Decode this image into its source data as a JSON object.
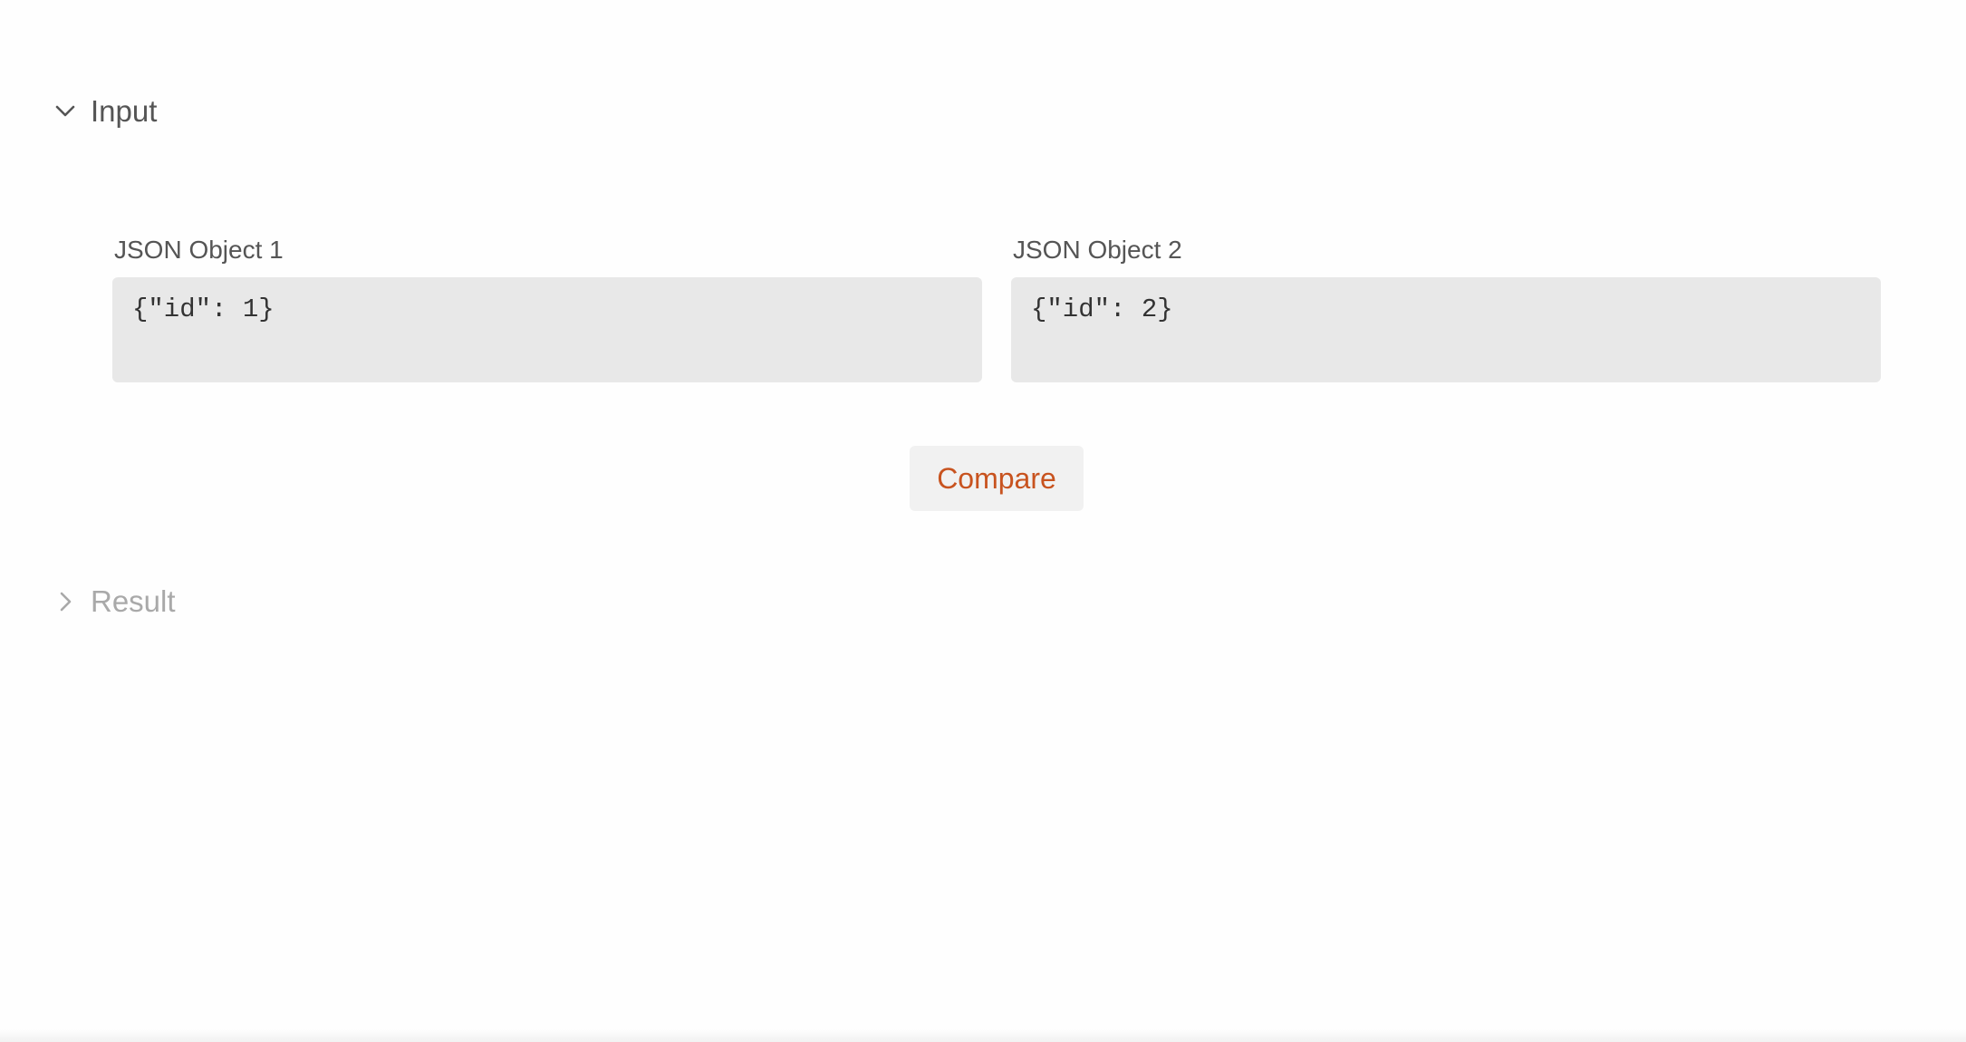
{
  "sections": {
    "input": {
      "title": "Input",
      "expanded": true,
      "icon": "chevron-down-icon"
    },
    "result": {
      "title": "Result",
      "expanded": false,
      "icon": "chevron-right-icon"
    }
  },
  "fields": {
    "object1": {
      "label": "JSON Object 1",
      "value": "{\"id\": 1}"
    },
    "object2": {
      "label": "JSON Object 2",
      "value": "{\"id\": 2}"
    }
  },
  "actions": {
    "compare_label": "Compare"
  },
  "colors": {
    "accent": "#c8531f",
    "input_background": "#e8e8e8",
    "button_background": "#f1f1f1",
    "muted_text": "#a9a9a9"
  }
}
